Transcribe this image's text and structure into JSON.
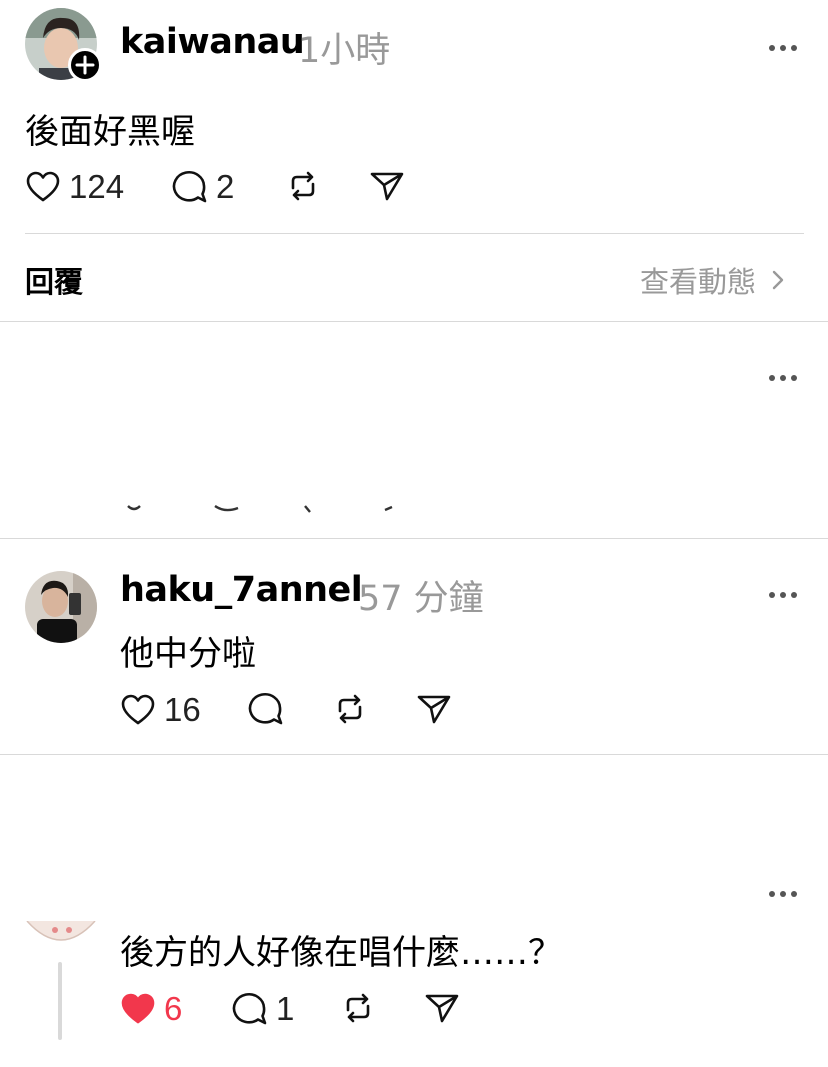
{
  "colors": {
    "text": "#000000",
    "muted": "#999999",
    "divider": "#d9d9d9",
    "like_active": "#f2374c"
  },
  "post": {
    "username": "kaiwanau",
    "time": "1小時",
    "text": "後面好黑喔",
    "likes": "124",
    "comments": "2",
    "icons": [
      "heart-icon",
      "comment-icon",
      "repost-icon",
      "share-icon",
      "follow-plus-icon",
      "more-icon"
    ]
  },
  "replies_bar": {
    "label": "回覆",
    "view_activity": "查看動態"
  },
  "replies": [
    {
      "username": "haku_7annel",
      "time": "57 分鐘",
      "text": "他中分啦",
      "likes": "16",
      "comments": ""
    },
    {
      "username": "",
      "time": "",
      "text": "後方的人好像在唱什麼……？",
      "likes": "6",
      "comments": "1",
      "liked": true
    }
  ]
}
